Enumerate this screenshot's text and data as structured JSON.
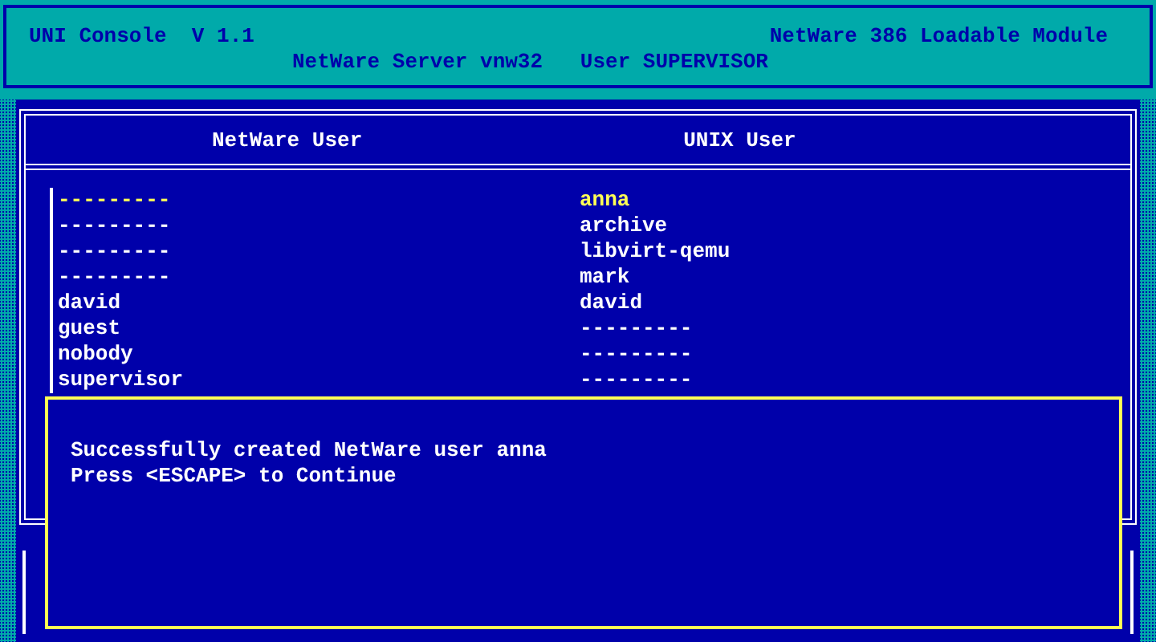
{
  "header": {
    "title": "UNI Console  V 1.1",
    "module": "NetWare 386 Loadable Module",
    "server": "NetWare Server vnw32   User SUPERVISOR"
  },
  "table": {
    "columns": [
      "NetWare User",
      "UNIX User"
    ],
    "rows": [
      {
        "netware": "---------",
        "unix": "anna",
        "selected": true
      },
      {
        "netware": "---------",
        "unix": "archive",
        "selected": false
      },
      {
        "netware": "---------",
        "unix": "libvirt-qemu",
        "selected": false
      },
      {
        "netware": "---------",
        "unix": "mark",
        "selected": false
      },
      {
        "netware": "david",
        "unix": "david",
        "selected": false
      },
      {
        "netware": "guest",
        "unix": "---------",
        "selected": false
      },
      {
        "netware": "nobody",
        "unix": "---------",
        "selected": false
      },
      {
        "netware": "supervisor",
        "unix": "---------",
        "selected": false
      }
    ]
  },
  "dialog": {
    "lines": [
      "Successfully created NetWare user anna",
      "Press <ESCAPE> to Continue"
    ]
  }
}
